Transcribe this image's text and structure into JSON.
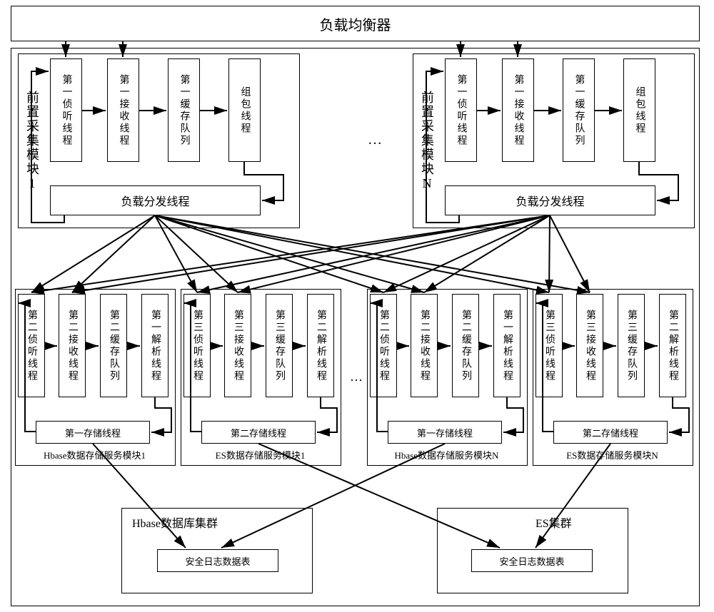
{
  "top": {
    "loadBalancer": "负载均衡器"
  },
  "collector": {
    "title1": "前置采集模块1",
    "titleN": "前置采集模块N",
    "c1": "第一侦听线程",
    "c2": "第一接收线程",
    "c3": "第一缓存队列",
    "c4": "组包线程",
    "dist": "负载分发线程"
  },
  "dots": "…",
  "hbaseMod": {
    "s1": "第二侦听线程",
    "s2": "第二接收线程",
    "s3": "第二缓存队列",
    "s4": "第一解析线程",
    "store": "第一存储线程",
    "label1": "Hbase数据存储服务模块1",
    "labelN": "Hbase数据存储服务模块N"
  },
  "esMod": {
    "s1": "第三侦听线程",
    "s2": "第三接收线程",
    "s3": "第三缓存队列",
    "s4": "第二解析线程",
    "store": "第二存储线程",
    "label1": "ES数据存储服务模块1",
    "labelN": "ES数据存储服务模块N"
  },
  "clusters": {
    "hbase": "Hbase数据库集群",
    "es": "ES集群",
    "table": "安全日志数据表"
  }
}
